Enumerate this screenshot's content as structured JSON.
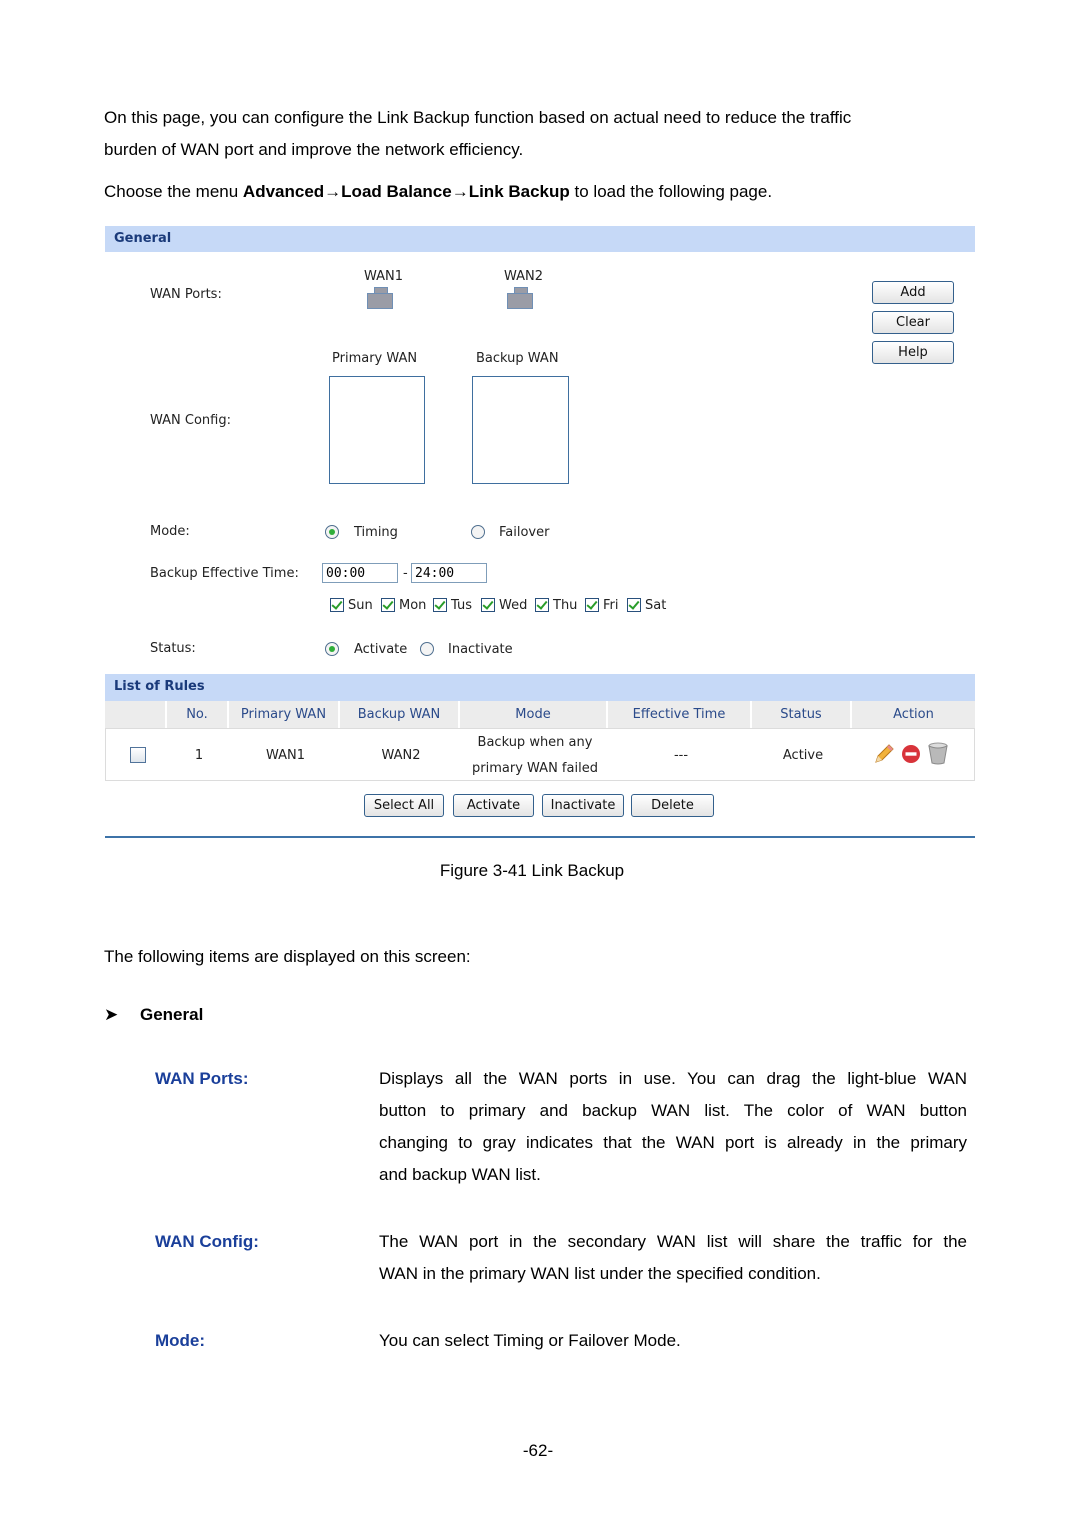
{
  "intro": {
    "line1": "On this page, you can configure the Link Backup function based on actual need to reduce the traffic",
    "line2": "burden of WAN port and improve the network efficiency.",
    "choose_prefix": "Choose the menu ",
    "menu_path": "Advanced→Load Balance→Link Backup",
    "choose_suffix": " to load the following page."
  },
  "general": {
    "title": "General",
    "wan_ports_label": "WAN Ports:",
    "ports": [
      {
        "name": "WAN1",
        "icon": "ethernet-port-icon"
      },
      {
        "name": "WAN2",
        "icon": "ethernet-port-icon"
      }
    ],
    "buttons": {
      "add": "Add",
      "clear": "Clear",
      "help": "Help"
    },
    "primary_wan_label": "Primary WAN",
    "backup_wan_label": "Backup WAN",
    "wan_config_label": "WAN Config:",
    "mode_label": "Mode:",
    "mode_options": [
      {
        "label": "Timing",
        "selected": true
      },
      {
        "label": "Failover",
        "selected": false
      }
    ],
    "backup_time_label": "Backup Effective Time:",
    "time_start": "00:00",
    "time_sep": "-",
    "time_end": "24:00",
    "days": [
      {
        "label": "Sun",
        "checked": true
      },
      {
        "label": "Mon",
        "checked": true
      },
      {
        "label": "Tus",
        "checked": true
      },
      {
        "label": "Wed",
        "checked": true
      },
      {
        "label": "Thu",
        "checked": true
      },
      {
        "label": "Fri",
        "checked": true
      },
      {
        "label": "Sat",
        "checked": true
      }
    ],
    "status_label": "Status:",
    "status_options": [
      {
        "label": "Activate",
        "selected": true
      },
      {
        "label": "Inactivate",
        "selected": false
      }
    ]
  },
  "rules": {
    "title": "List of Rules",
    "columns": [
      "",
      "No.",
      "Primary WAN",
      "Backup WAN",
      "Mode",
      "Effective Time",
      "Status",
      "Action"
    ],
    "rows": [
      {
        "checked": false,
        "no": "1",
        "primary": "WAN1",
        "backup": "WAN2",
        "mode_line1": "Backup when any",
        "mode_line2": "primary WAN failed",
        "effective_time": "---",
        "status": "Active",
        "actions": [
          "edit-pencil-icon",
          "disable-icon",
          "delete-trash-icon"
        ]
      }
    ],
    "buttons": {
      "select_all": "Select All",
      "activate": "Activate",
      "inactivate": "Inactivate",
      "delete": "Delete"
    }
  },
  "figure_caption": "Figure 3-41 Link Backup",
  "items_intro": "The following items are displayed on this screen:",
  "section_heading": "General",
  "descriptions": [
    {
      "term": "WAN Ports:",
      "lines": [
        "Displays all the WAN ports in use. You can drag the light-blue WAN",
        "button to primary and backup WAN list. The color of WAN button",
        "changing to gray indicates that the WAN port is already in the primary",
        "and backup WAN list."
      ]
    },
    {
      "term": "WAN Config:",
      "lines": [
        "The WAN port in the secondary WAN list will share the traffic for the",
        "WAN in the primary WAN list under the specified condition."
      ]
    },
    {
      "term": "Mode:",
      "lines": [
        "You can select Timing or Failover Mode."
      ]
    }
  ],
  "page_number": "-62-",
  "colors": {
    "header_bar": "#c6d9f7",
    "term_blue": "#1a3f9a",
    "divider": "#3d73a8"
  }
}
